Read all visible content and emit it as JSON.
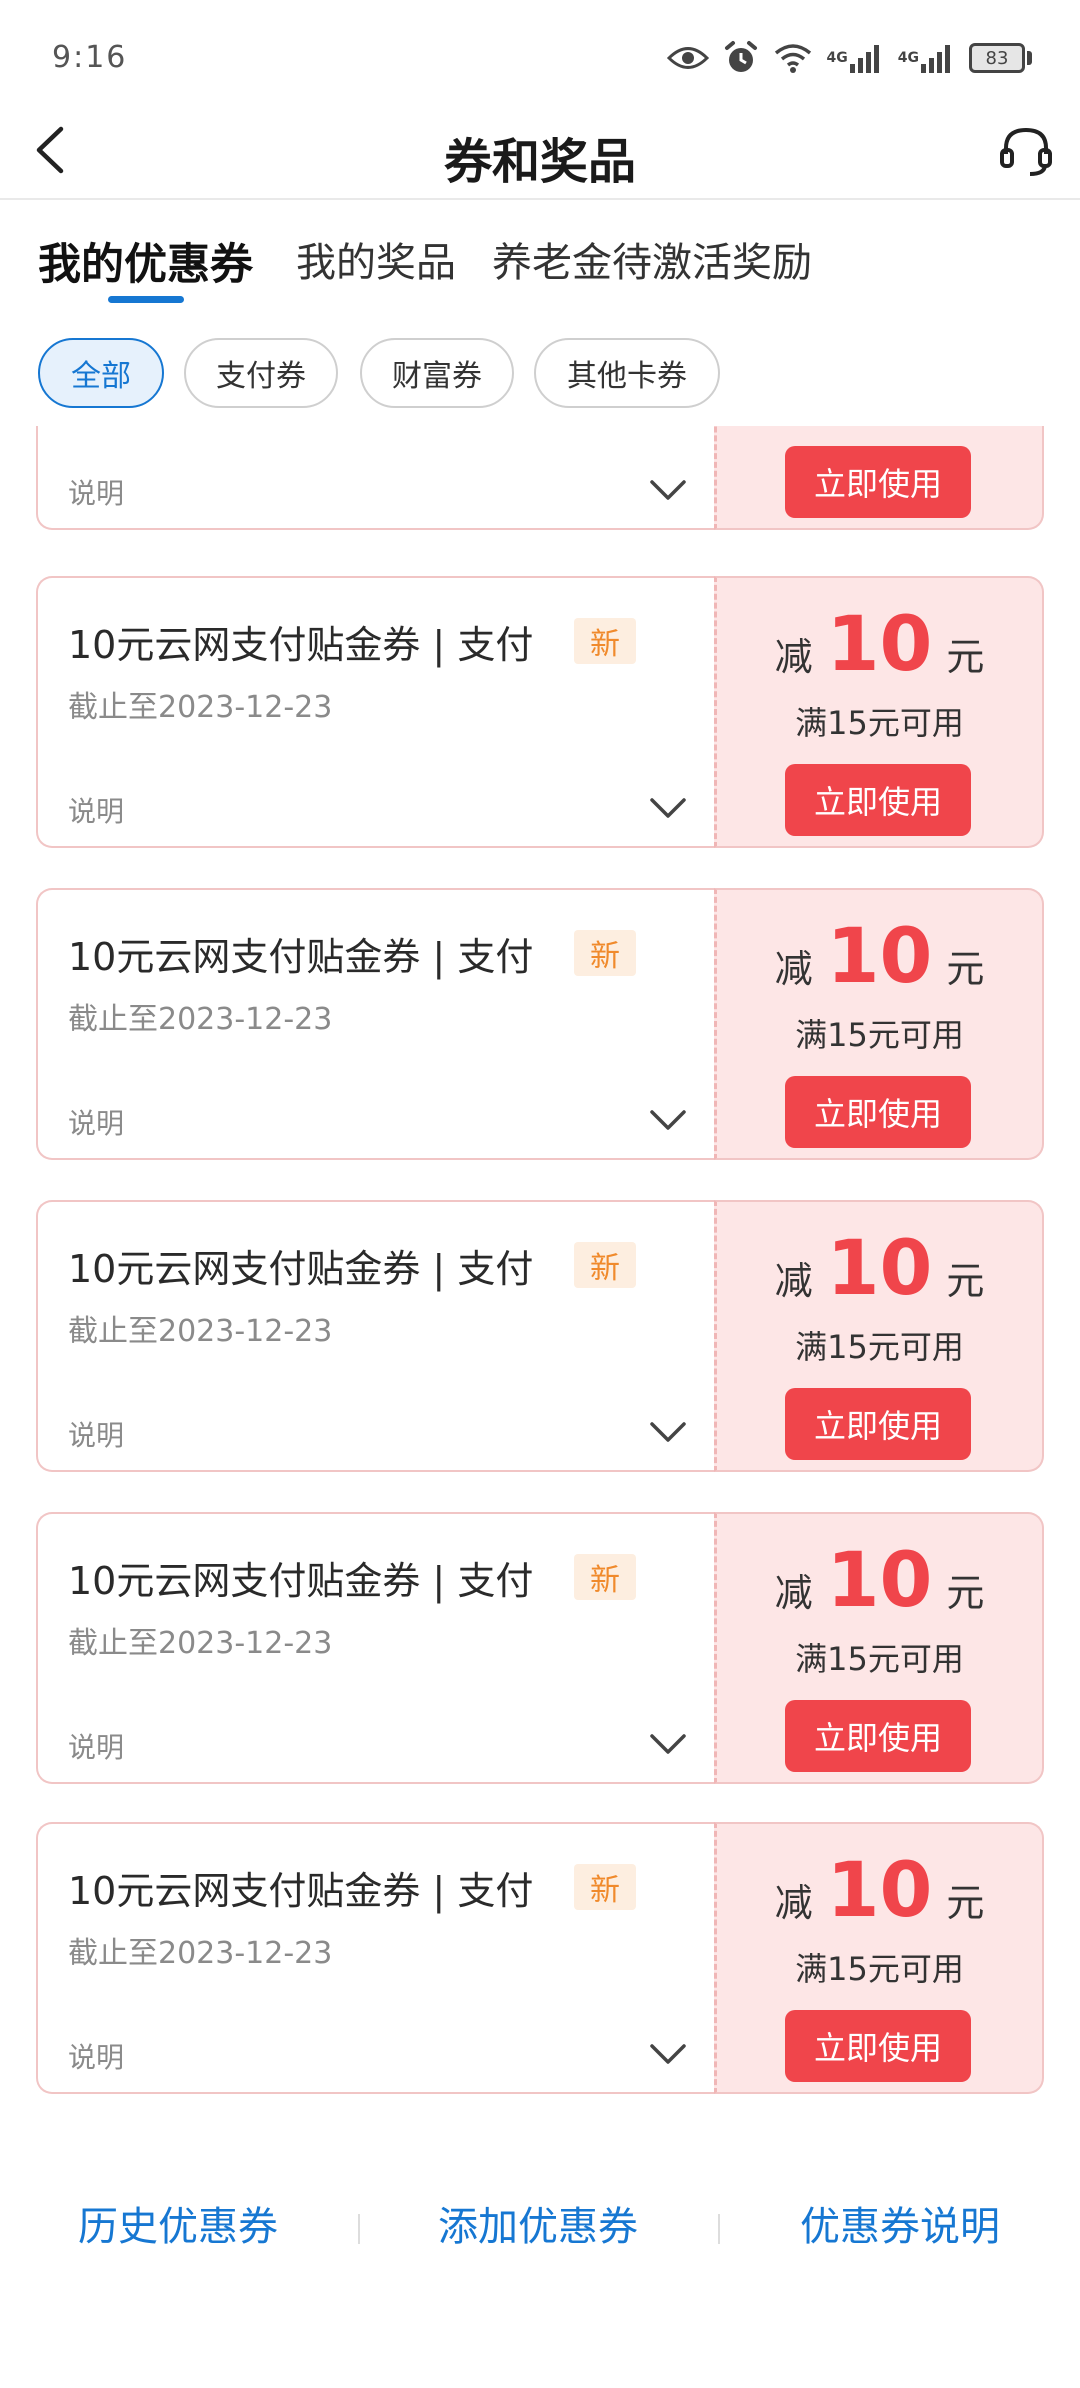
{
  "status_bar": {
    "time": "9:16",
    "network_1": "4G",
    "network_2": "4G",
    "battery": "83"
  },
  "nav": {
    "title": "券和奖品"
  },
  "tabs": [
    {
      "label": "我的优惠券",
      "active": true
    },
    {
      "label": "我的奖品",
      "active": false
    },
    {
      "label": "养老金待激活奖励",
      "active": false
    }
  ],
  "filters": [
    {
      "label": "全部",
      "active": true
    },
    {
      "label": "支付券",
      "active": false
    },
    {
      "label": "财富券",
      "active": false
    },
    {
      "label": "其他卡券",
      "active": false
    }
  ],
  "coupons": [
    {
      "title": "",
      "badge": "",
      "expiry": "",
      "note": "说明",
      "prefix": "",
      "amount": "",
      "unit": "",
      "condition": "",
      "button": "立即使用"
    },
    {
      "title": "10元云网支付贴金券 | 支付",
      "badge": "新",
      "expiry": "截止至2023-12-23",
      "note": "说明",
      "prefix": "减",
      "amount": "10",
      "unit": "元",
      "condition": "满15元可用",
      "button": "立即使用"
    },
    {
      "title": "10元云网支付贴金券 | 支付",
      "badge": "新",
      "expiry": "截止至2023-12-23",
      "note": "说明",
      "prefix": "减",
      "amount": "10",
      "unit": "元",
      "condition": "满15元可用",
      "button": "立即使用"
    },
    {
      "title": "10元云网支付贴金券 | 支付",
      "badge": "新",
      "expiry": "截止至2023-12-23",
      "note": "说明",
      "prefix": "减",
      "amount": "10",
      "unit": "元",
      "condition": "满15元可用",
      "button": "立即使用"
    },
    {
      "title": "10元云网支付贴金券 | 支付",
      "badge": "新",
      "expiry": "截止至2023-12-23",
      "note": "说明",
      "prefix": "减",
      "amount": "10",
      "unit": "元",
      "condition": "满15元可用",
      "button": "立即使用"
    },
    {
      "title": "10元云网支付贴金券 | 支付",
      "badge": "新",
      "expiry": "截止至2023-12-23",
      "note": "说明",
      "prefix": "减",
      "amount": "10",
      "unit": "元",
      "condition": "满15元可用",
      "button": "立即使用"
    }
  ],
  "bottom_links": [
    {
      "label": "历史优惠券"
    },
    {
      "label": "添加优惠券"
    },
    {
      "label": "优惠券说明"
    }
  ],
  "colors": {
    "brand_blue": "#1677d2",
    "coupon_red": "#f0454b",
    "coupon_bg": "#fde6e6",
    "badge_orange": "#f08a2c"
  },
  "icons": {
    "back": "chevron-left-icon",
    "service": "headset-icon",
    "expand": "chevron-down-icon"
  }
}
